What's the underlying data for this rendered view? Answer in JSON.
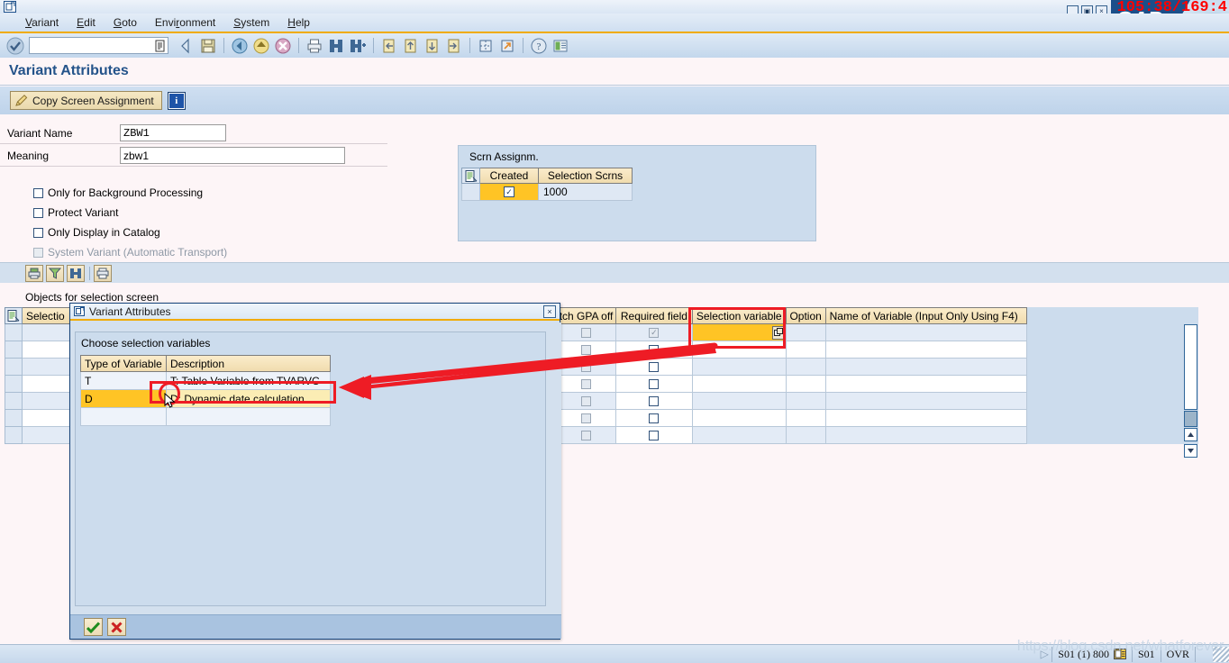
{
  "window": {
    "title_icon": "sap-session-icon",
    "minimize": "_",
    "restore": "▣",
    "close": "×",
    "logo_text": "SAP",
    "overlay_timer": "105:38/169:4"
  },
  "menu": {
    "items": [
      {
        "label": "Variant"
      },
      {
        "label": "Edit"
      },
      {
        "label": "Goto"
      },
      {
        "label": "Environment"
      },
      {
        "label": "System"
      },
      {
        "label": "Help"
      }
    ]
  },
  "toolbar": {
    "command_value": "",
    "command_placeholder": "",
    "icons": [
      "back-icon",
      "save-icon",
      "exit-icon",
      "up-icon",
      "cancel-icon",
      "print-icon",
      "find-icon",
      "find-next-icon",
      "first-page-icon",
      "previous-page-icon",
      "next-page-icon",
      "last-page-icon",
      "new-session-icon",
      "create-shortcut-icon",
      "help-icon",
      "customize-icon"
    ]
  },
  "page": {
    "title": "Variant Attributes"
  },
  "app_toolbar": {
    "copy_screen_assignment": "Copy Screen Assignment",
    "info_button": "i"
  },
  "form": {
    "variant_name_label": "Variant Name",
    "variant_name_value": "ZBW1",
    "meaning_label": "Meaning",
    "meaning_value": "zbw1",
    "checkboxes": [
      {
        "label": "Only for Background Processing",
        "checked": false,
        "disabled": false
      },
      {
        "label": "Protect Variant",
        "checked": false,
        "disabled": false
      },
      {
        "label": "Only Display in Catalog",
        "checked": false,
        "disabled": false
      },
      {
        "label": "System Variant (Automatic Transport)",
        "checked": false,
        "disabled": true
      }
    ]
  },
  "scrn_assignment": {
    "caption": "Scrn Assignm.",
    "columns": [
      "Created",
      "Selection Scrns"
    ],
    "rows": [
      {
        "created": true,
        "selection_scrns": "1000"
      }
    ]
  },
  "grid_toolbar": {
    "buttons": [
      "print-icon",
      "filter-icon",
      "find-icon",
      "layout-icon"
    ]
  },
  "objects_panel": {
    "caption": "Objects for selection screen",
    "columns": [
      "Selectio",
      "tch GPA off",
      "Required field",
      "Selection variable",
      "Option",
      "Name of Variable (Input Only Using F4)"
    ],
    "rows": [
      {
        "gpa_off": false,
        "gpa_disabled": true,
        "required": true,
        "required_disabled": true,
        "selection_variable": "",
        "variable_highlighted": true,
        "option": "",
        "name_of_variable": ""
      },
      {
        "gpa_off": false,
        "gpa_disabled": true,
        "required": false,
        "required_disabled": false,
        "selection_variable": "",
        "variable_highlighted": false,
        "option": "",
        "name_of_variable": ""
      },
      {
        "gpa_off": false,
        "gpa_disabled": true,
        "required": false,
        "required_disabled": false,
        "selection_variable": "",
        "variable_highlighted": false,
        "option": "",
        "name_of_variable": ""
      },
      {
        "gpa_off": false,
        "gpa_disabled": true,
        "required": false,
        "required_disabled": false,
        "selection_variable": "",
        "variable_highlighted": false,
        "option": "",
        "name_of_variable": ""
      },
      {
        "gpa_off": false,
        "gpa_disabled": true,
        "required": false,
        "required_disabled": false,
        "selection_variable": "",
        "variable_highlighted": false,
        "option": "",
        "name_of_variable": ""
      },
      {
        "gpa_off": false,
        "gpa_disabled": true,
        "required": false,
        "required_disabled": false,
        "selection_variable": "",
        "variable_highlighted": false,
        "option": "",
        "name_of_variable": ""
      },
      {
        "gpa_off": false,
        "gpa_disabled": true,
        "required": false,
        "required_disabled": false,
        "selection_variable": "",
        "variable_highlighted": false,
        "option": "",
        "name_of_variable": ""
      }
    ]
  },
  "dialog": {
    "title": "Variant Attributes",
    "close_label": "×",
    "section_label": "Choose selection variables",
    "columns": [
      "Type of Variable",
      "Description"
    ],
    "rows": [
      {
        "type": "T",
        "description": "T: Table Variable from TVARVC",
        "selected": false
      },
      {
        "type": "D",
        "description": "D: Dynamic date calculation",
        "selected": true
      },
      {
        "type": "",
        "description": "",
        "selected": false
      }
    ],
    "confirm_label": "✔",
    "cancel_label": "✖"
  },
  "status_bar": {
    "system": "S01 (1) 800",
    "session_icon": "server-icon",
    "instance": "S01",
    "insert_mode": "OVR",
    "watermark": "https://blog.csdn.net/whatforever"
  },
  "colors": {
    "accent_orange": "#f0ab00",
    "title_blue": "#24538a",
    "highlight_yellow": "#ffc425",
    "selected_row_yellow": "#fbedb4",
    "annotation_red": "#ee1c25",
    "header_beige": "#f0dcae",
    "panel_blue": "#ccdced"
  }
}
